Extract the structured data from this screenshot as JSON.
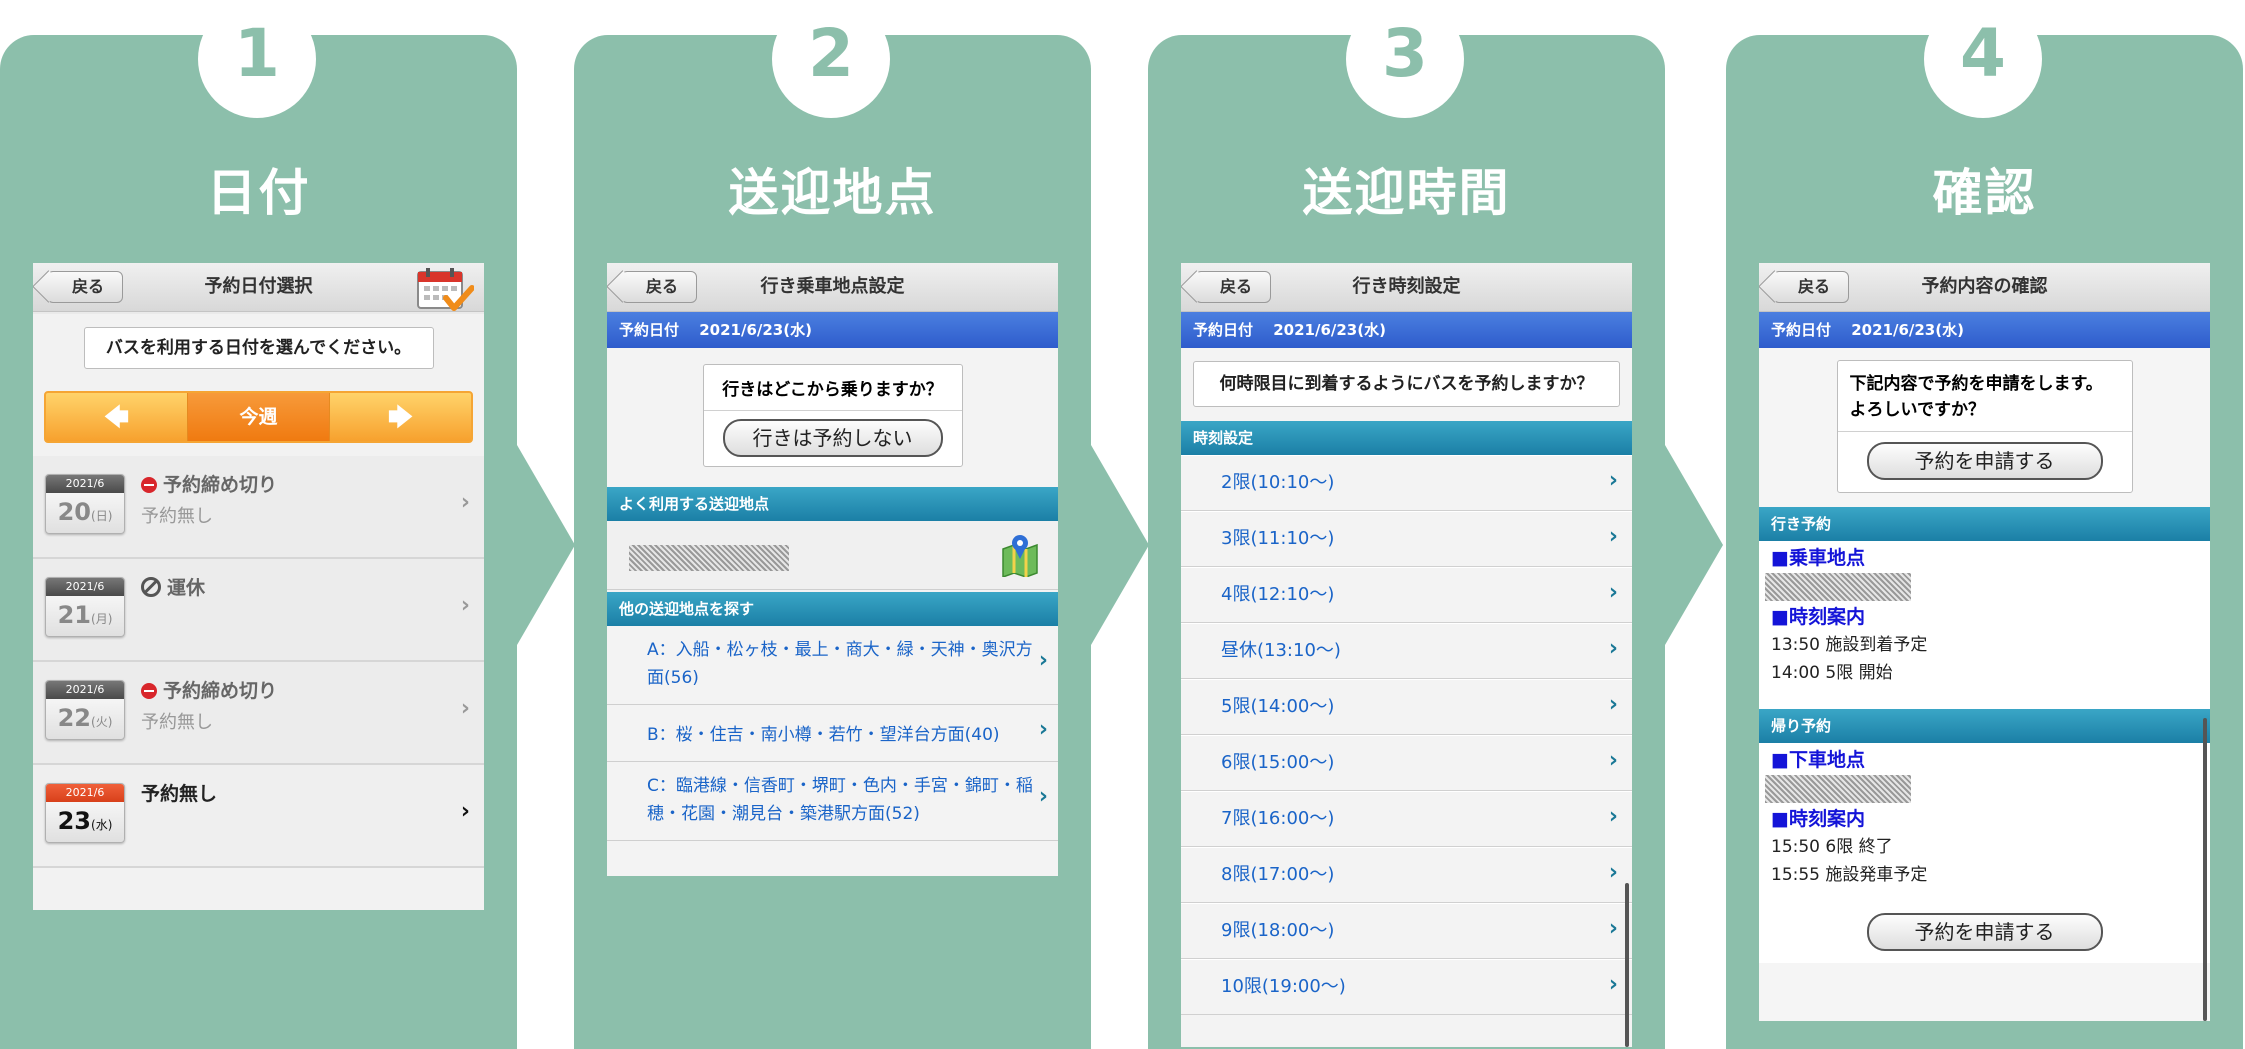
{
  "steps": [
    {
      "number": "1",
      "title": "日付"
    },
    {
      "number": "2",
      "title": "送迎地点"
    },
    {
      "number": "3",
      "title": "送迎時間"
    },
    {
      "number": "4",
      "title": "確認"
    }
  ],
  "screen1": {
    "back_label": "戻る",
    "title": "予約日付選択",
    "calendar_icon": "calendar-check-icon",
    "instruction": "バスを利用する日付を選んでください。",
    "week_nav": {
      "prev": "🡄",
      "current": "今週",
      "next": "🡆"
    },
    "days": [
      {
        "month": "2021/6",
        "day": "20",
        "weekday": "(日)",
        "status": "予約締め切り",
        "status_icon": "no-entry-icon",
        "sub": "予約無し"
      },
      {
        "month": "2021/6",
        "day": "21",
        "weekday": "(月)",
        "status": "運休",
        "status_icon": "prohibited-icon",
        "sub": ""
      },
      {
        "month": "2021/6",
        "day": "22",
        "weekday": "(火)",
        "status": "予約締め切り",
        "status_icon": "no-entry-icon",
        "sub": "予約無し"
      },
      {
        "month": "2021/6",
        "day": "23",
        "weekday": "(水)",
        "status": "予約無し",
        "status_icon": "",
        "sub": ""
      }
    ]
  },
  "screen2": {
    "back_label": "戻る",
    "title": "行き乗車地点設定",
    "date_label": "予約日付　 2021/6/23(水)",
    "question": "行きはどこから乗りますか？",
    "skip_button": "行きは予約しない",
    "frequent_header": "よく利用する送迎地点",
    "map_icon": "map-pin-icon",
    "other_header": "他の送迎地点を探す",
    "areas": [
      "A：入船・松ヶ枝・最上・商大・緑・天神・奥沢方面(56)",
      "B：桜・住吉・南小樽・若竹・望洋台方面(40)",
      "C：臨港線・信香町・堺町・色内・手宮・錦町・稲穂・花園・潮見台・築港駅方面(52)"
    ]
  },
  "screen3": {
    "back_label": "戻る",
    "title": "行き時刻設定",
    "date_label": "予約日付　 2021/6/23(水)",
    "question": "何時限目に到着するようにバスを予約しますか？",
    "section": "時刻設定",
    "times": [
      "2限(10:10〜)",
      "3限(11:10〜)",
      "4限(12:10〜)",
      "昼休(13:10〜)",
      "5限(14:00〜)",
      "6限(15:00〜)",
      "7限(16:00〜)",
      "8限(17:00〜)",
      "9限(18:00〜)",
      "10限(19:00〜)"
    ]
  },
  "screen4": {
    "back_label": "戻る",
    "title": "予約内容の確認",
    "date_label": "予約日付　 2021/6/23(水)",
    "confirm_text": "下記内容で予約を申請をします。よろしいですか？",
    "submit_button": "予約を申請する",
    "outbound": {
      "header": "行き予約",
      "stop_label": "■乗車地点",
      "time_label": "■時刻案内",
      "lines": [
        "13:50 施設到着予定",
        "14:00 5限 開始"
      ]
    },
    "inbound": {
      "header": "帰り予約",
      "stop_label": "■下車地点",
      "time_label": "■時刻案内",
      "lines": [
        "15:50 6限 終了",
        "15:55 施設発車予定"
      ]
    },
    "submit_button_bottom": "予約を申請する"
  },
  "colors": {
    "panel": "#8cbfab",
    "date_bar": "#2e5ccc",
    "section_bar": "#1b7fa6",
    "week_nav": "#f7a12e",
    "link_blue": "#1a64c8"
  }
}
